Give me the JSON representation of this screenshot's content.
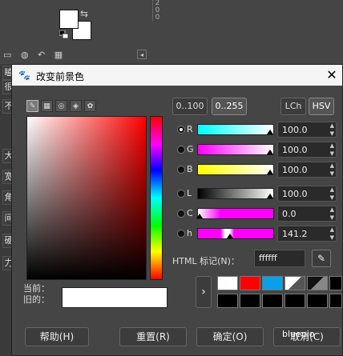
{
  "background": {
    "ruler_digits": [
      "2",
      "0",
      "0"
    ],
    "side_chars": [
      "瞌",
      "很",
      "不",
      "大",
      "宽",
      "角",
      "间",
      "硬",
      "力"
    ]
  },
  "dialog": {
    "title": "改变前景色",
    "close_label": "✕",
    "ranges": [
      "0..100",
      "0..255"
    ],
    "models": [
      "LCh",
      "HSV"
    ],
    "channels": [
      {
        "label": "R",
        "value": "100.0",
        "checked": true
      },
      {
        "label": "G",
        "value": "100.0",
        "checked": false
      },
      {
        "label": "B",
        "value": "100.0",
        "checked": false
      },
      {
        "label": "L",
        "value": "100.0",
        "checked": false
      },
      {
        "label": "C",
        "value": "0.0",
        "checked": false
      },
      {
        "label": "h",
        "value": "141.2",
        "checked": false
      }
    ],
    "html_label": "HTML 标记(N)：",
    "hex_value": "ffffff",
    "current_label": "当前：",
    "old_label": "旧的：",
    "history_colors": [
      "#ffffff",
      "#ff0000",
      "#0aa0e8",
      "#ffffff",
      "#888888",
      "#000000"
    ],
    "buttons": {
      "help": "帮助(H)",
      "reset": "重置(R)",
      "ok": "确定(O)",
      "cancel": "取消(C)"
    },
    "colors": {
      "current": "#ffffff",
      "accent": "#454545"
    }
  },
  "watermark": "bluepio"
}
